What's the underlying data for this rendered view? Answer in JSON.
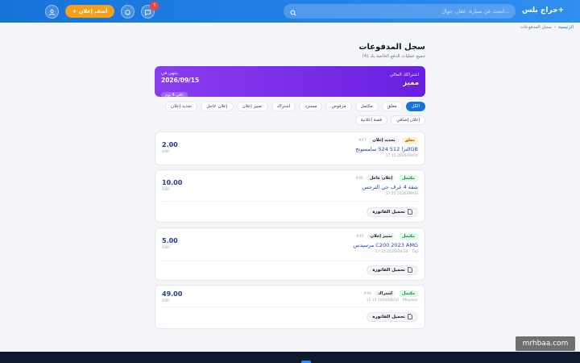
{
  "header": {
    "logo": "حراج بلس+",
    "search_placeholder": "ابحث عن سيارة، عقار، جوال...",
    "add_button_label": "+ أضف إعلان",
    "notification_count": "1"
  },
  "breadcrumb": {
    "home": "الرئيسية",
    "separator": "›",
    "current": "سجل المدفوعات"
  },
  "page": {
    "title": "سجل المدفوعات",
    "subtitle": "جميع عمليات الدفع الخاصة بك (4)"
  },
  "subscription": {
    "current_label": "اشتراكك الحالي",
    "plan": "مميز",
    "ends_label": "ينتهي في",
    "end_date": "2026/09/15",
    "remaining": "باقي 4 يوم"
  },
  "filters": [
    "الكل",
    "معلق",
    "مكتمل",
    "مرفوض",
    "مسترد",
    "اشتراك",
    "تمييز إعلان",
    "إعلان عاجل",
    "تجديد إعلان",
    "إعلان إضافي",
    "قصة إعلانية"
  ],
  "payments": [
    {
      "status": "معلق",
      "status_type": "pending",
      "type": "تجديد إعلان",
      "id": "#47",
      "title": "سامسونج S24 الترا 512GB",
      "extra": "",
      "date": "17:15 2026/09/04",
      "amount": "2.00",
      "currency": "SAR",
      "has_download": false
    },
    {
      "status": "مكتمل",
      "status_type": "paid",
      "type": "إعلان عاجل",
      "id": "#46",
      "title": "شقة 4 غرف حي النرجس",
      "extra": "",
      "date": "17:15 2026/09/04",
      "amount": "10.00",
      "currency": "SAR",
      "download_label": "تحميل الفاتورة",
      "has_download": true
    },
    {
      "status": "مكتمل",
      "status_type": "paid",
      "type": "تمييز إعلان",
      "id": "#45",
      "title": "مرسيدس C200 2023 AMG",
      "extra": "Tap",
      "date": "17:15 2026/08/30",
      "amount": "5.00",
      "currency": "SAR",
      "download_label": "تحميل الفاتورة",
      "has_download": true
    },
    {
      "status": "مكتمل",
      "status_type": "paid",
      "type": "اشتراك",
      "id": "#44",
      "title": "",
      "extra": "Moyasar",
      "date": "15:15 2026/08/16",
      "amount": "49.00",
      "currency": "SAR",
      "download_label": "تحميل الفاتورة",
      "has_download": true
    }
  ],
  "watermark": "mrhbaa.com"
}
